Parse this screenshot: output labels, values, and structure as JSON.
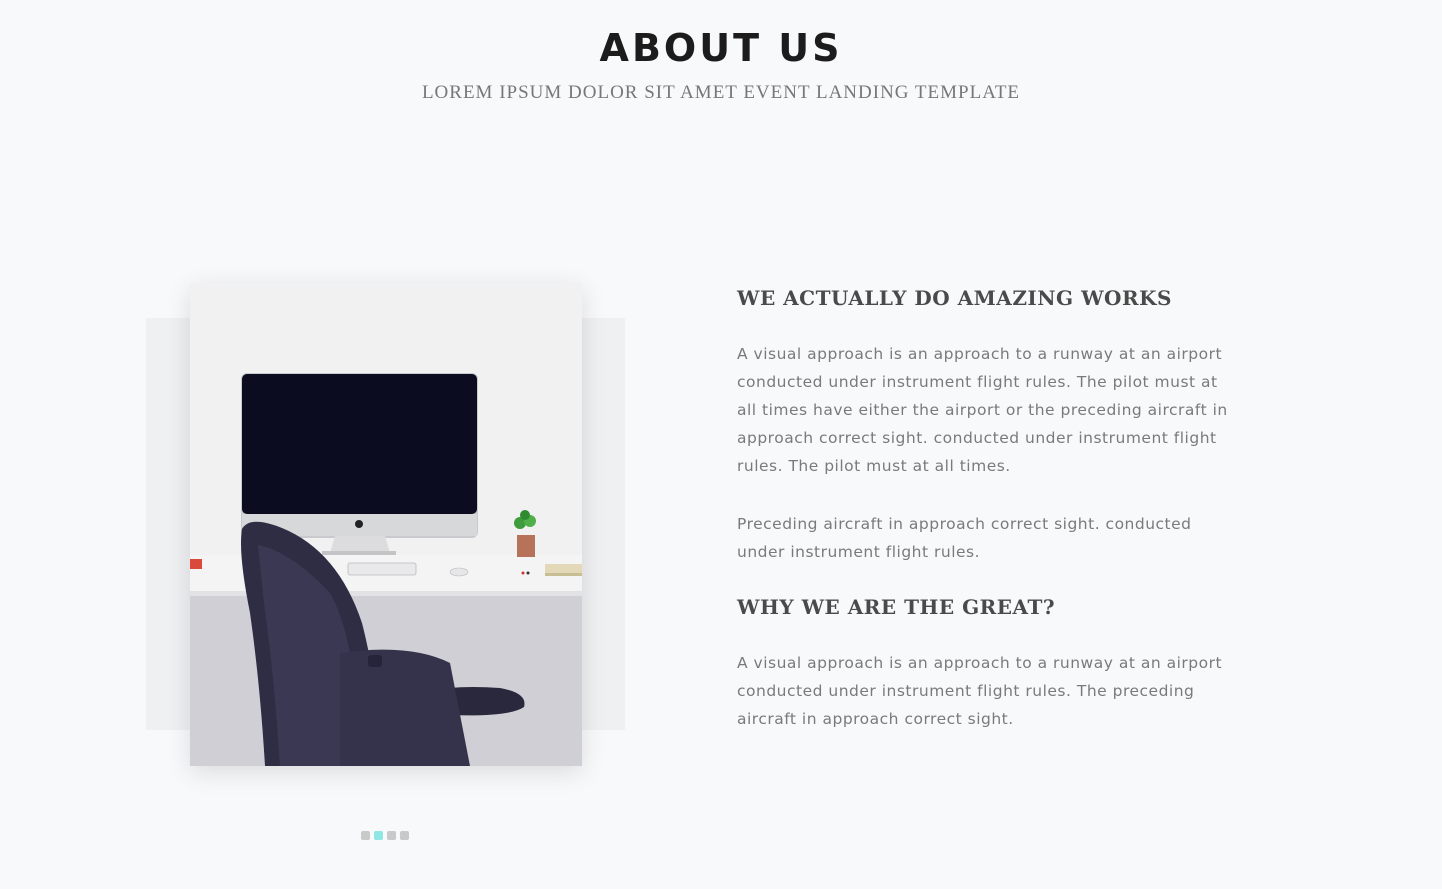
{
  "header": {
    "title": "ABOUT US",
    "subtitle": "LOREM IPSUM DOLOR SIT AMET EVENT LANDING TEMPLATE"
  },
  "about": {
    "heading_1": "WE ACTUALLY DO AMAZING WORKS",
    "paragraph_1": [
      "A visual approach is an approach to a runway at an airport",
      "conducted under instrument flight rules. The pilot must at",
      "all times have either the airport or the preceding aircraft in",
      "approach correct sight. conducted under instrument flight",
      "rules. The pilot must at all times."
    ],
    "paragraph_2": [
      "Preceding aircraft in approach correct sight. conducted",
      "under instrument flight rules."
    ],
    "heading_2": "WHY WE ARE THE GREAT?",
    "paragraph_3": [
      "A visual approach is an approach to a runway at an airport",
      "conducted under instrument flight rules. The preceding",
      "aircraft in approach correct sight."
    ]
  },
  "slider": {
    "image_alt": "desk-with-imac-and-office-chair",
    "active_dot": 1,
    "dot_count": 4
  },
  "colors": {
    "background": "#f8f9fb",
    "title": "#1c1c1c",
    "heading": "#4a4a4a",
    "body_text": "#7a7a7a",
    "dot_active": "#8fe6e2",
    "dot_inactive": "#c9c9c9"
  }
}
